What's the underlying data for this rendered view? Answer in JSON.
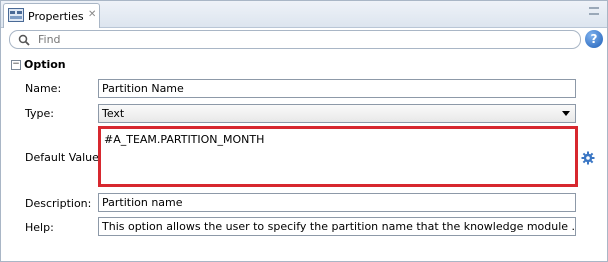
{
  "tab": {
    "title": "Properties"
  },
  "find": {
    "placeholder": "Find"
  },
  "section": {
    "title": "Option",
    "collapse_symbol": "−"
  },
  "fields": {
    "name": {
      "label": "Name:",
      "value": "Partition Name"
    },
    "type": {
      "label": "Type:",
      "value": "Text"
    },
    "default_value": {
      "label": "Default Value:",
      "value": "#A_TEAM.PARTITION_MONTH"
    },
    "description": {
      "label": "Description:",
      "value": "Partition name"
    },
    "help": {
      "label": "Help:",
      "value": "This option allows the user to specify the partition name that the knowledge module ..."
    }
  },
  "icons": {
    "tab": "properties-icon",
    "close": "close-icon",
    "search": "search-icon",
    "help": "help-icon",
    "gear": "gear-icon",
    "dropdown": "chevron-down-icon"
  },
  "colors": {
    "highlight_border": "#d7282f",
    "help_blue": "#1f5fb8"
  }
}
